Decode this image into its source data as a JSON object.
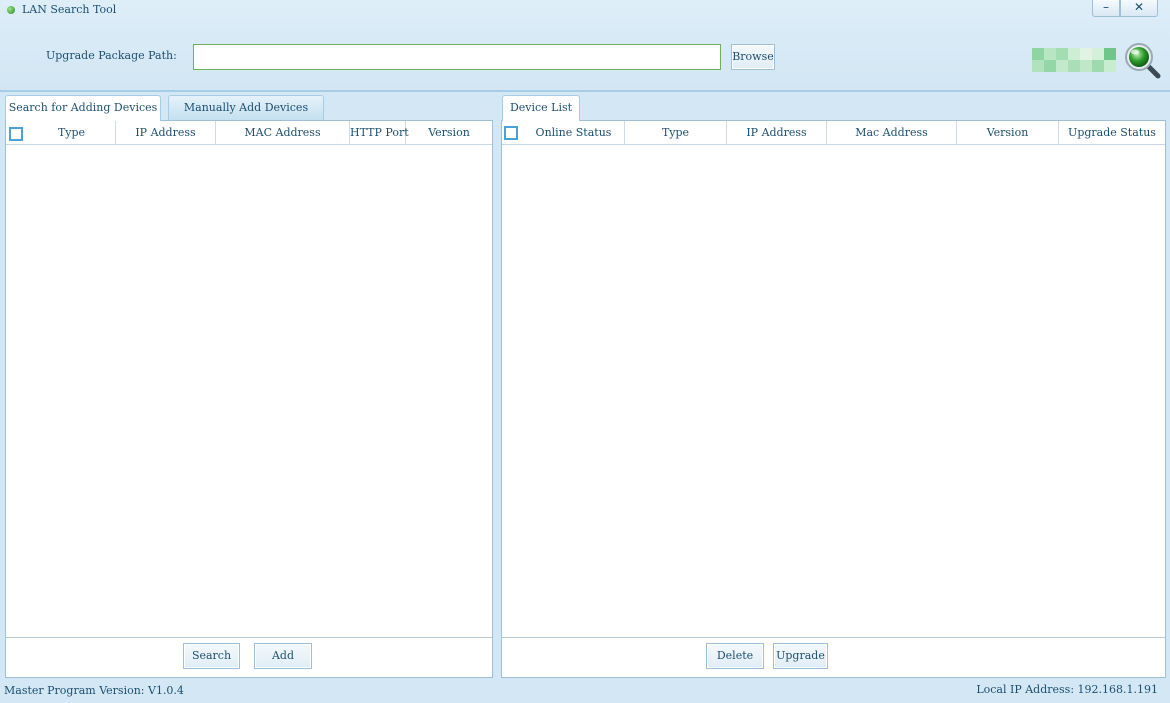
{
  "window": {
    "title": "LAN Search Tool",
    "minimize_label": "–",
    "close_label": "✕"
  },
  "upgrade": {
    "label": "Upgrade Package Path:",
    "value": "",
    "browse_label": "Browse"
  },
  "left_tabs": [
    {
      "label": "Search for Adding Devices",
      "active": true
    },
    {
      "label": "Manually Add Devices",
      "active": false
    }
  ],
  "left_table": {
    "columns": [
      "Type",
      "IP Address",
      "MAC Address",
      "HTTP Port",
      "Version"
    ],
    "rows": []
  },
  "left_buttons": {
    "search_label": "Search",
    "add_label": "Add"
  },
  "right_tab": {
    "label": "Device List"
  },
  "right_table": {
    "columns": [
      "Online Status",
      "Type",
      "IP Address",
      "Mac Address",
      "Version",
      "Upgrade Status"
    ],
    "rows": []
  },
  "right_buttons": {
    "delete_label": "Delete",
    "upgrade_label": "Upgrade"
  },
  "status": {
    "version_text": "Master Program Version: V1.0.4",
    "local_ip_text": "Local IP Address: 192.168.1.191"
  },
  "colors": {
    "accent": "#4aa0d8",
    "background": "#d3e7f4",
    "logo_green": "#2e9b2e"
  },
  "icons": {
    "app": "green-dot-icon",
    "logo": "magnifier-globe-icon"
  }
}
